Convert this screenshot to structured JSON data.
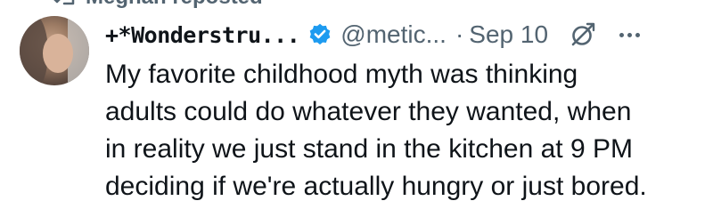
{
  "repost": {
    "text": "Meghan reposted",
    "icon": "repost-icon"
  },
  "tweet": {
    "author": {
      "display_name": "+*Wonderstru...",
      "verified": true,
      "handle": "@metic...",
      "avatar": "avatar"
    },
    "separator": "·",
    "timestamp": "Sep 10",
    "body_lines": [
      "My favorite childhood myth was thinking",
      "adults could do whatever they wanted, when",
      "in reality we just stand in the kitchen at 9 PM",
      "deciding if we're actually hungry or just bored."
    ],
    "icons": {
      "verified": "verified-badge-icon",
      "grok": "grok-icon",
      "more": "more-options-icon"
    }
  },
  "colors": {
    "text_primary": "#0f1419",
    "text_secondary": "#536471",
    "verified_blue": "#1d9bf0",
    "background": "#ffffff"
  }
}
